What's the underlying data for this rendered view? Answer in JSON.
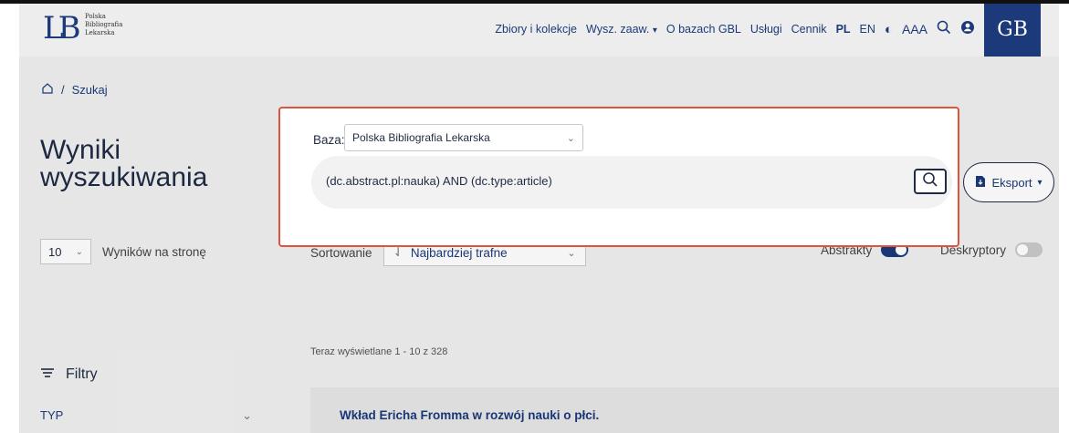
{
  "header": {
    "logo_mark": "LB",
    "logo_lines": [
      "Polska",
      "Bibliografia",
      "Lekarska"
    ],
    "nav": {
      "collections": "Zbiory i kolekcje",
      "advanced_search": "Wysz. zaaw.",
      "about": "O bazach GBL",
      "services": "Usługi",
      "pricing": "Cennik",
      "lang_pl": "PL",
      "lang_en": "EN",
      "font_size": "AAA"
    },
    "brand_glyph": "GB"
  },
  "breadcrumb": {
    "current": "Szukaj"
  },
  "page_title": "Wyniki wyszukiwania",
  "search_dialog": {
    "db_label": "Baza:",
    "db_value": "Polska Bibliografia Lekarska",
    "query": "(dc.abstract.pl:nauka) AND (dc.type:article)"
  },
  "export": {
    "label": "Eksport"
  },
  "per_page": {
    "value": "10",
    "label": "Wyników na stronę"
  },
  "sort": {
    "label": "Sortowanie",
    "value": "Najbardziej trafne"
  },
  "toggles": {
    "abstracts": {
      "label": "Abstrakty",
      "on": true
    },
    "descriptors": {
      "label": "Deskryptory",
      "on": false
    }
  },
  "status_line": "Teraz wyświetlane 1 - 10 z 328",
  "filters": {
    "title": "Filtry",
    "first_filter": "TYP"
  },
  "results": [
    {
      "title": "Wkład Ericha Fromma w rozwój nauki o płci."
    }
  ],
  "colors": {
    "accent": "#1c3a7a",
    "highlight_border": "#e2533d"
  }
}
